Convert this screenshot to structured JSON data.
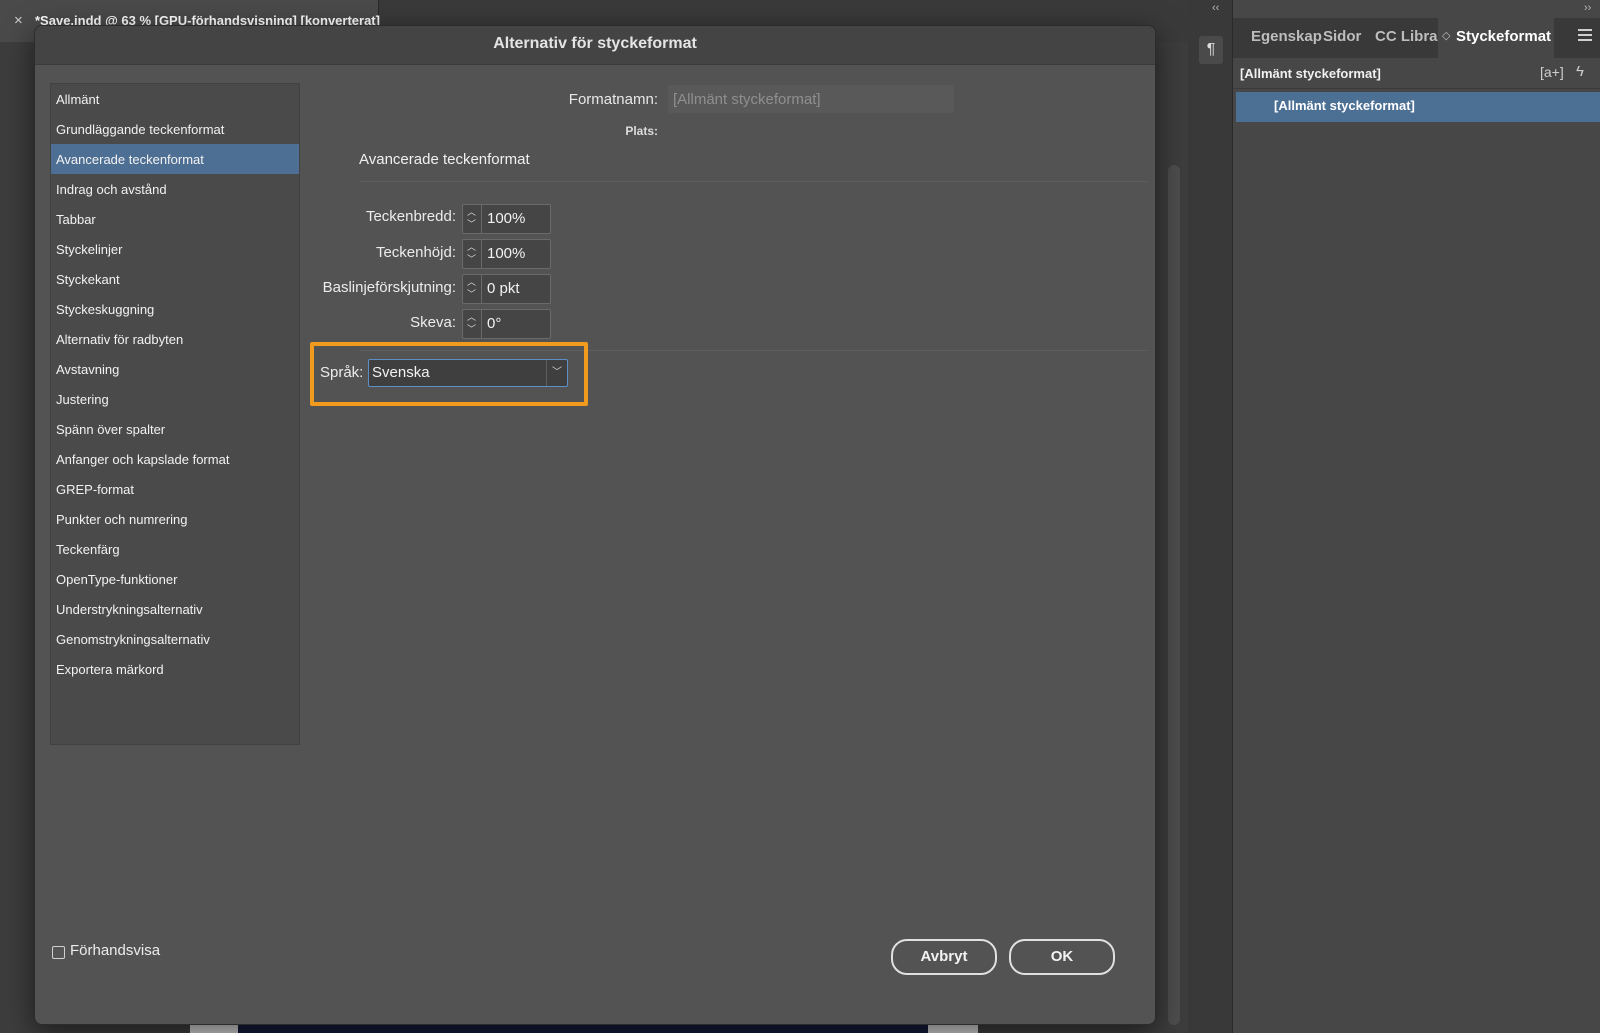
{
  "document_tab": {
    "close": "×",
    "title": "*Save.indd @ 63 % [GPU-förhandsvisning] [konverterat]"
  },
  "dialog": {
    "title": "Alternativ för styckeformat",
    "categories": [
      "Allmänt",
      "Grundläggande teckenformat",
      "Avancerade teckenformat",
      "Indrag och avstånd",
      "Tabbar",
      "Styckelinjer",
      "Styckekant",
      "Styckeskuggning",
      "Alternativ för radbyten",
      "Avstavning",
      "Justering",
      "Spänn över spalter",
      "Anfanger och kapslade format",
      "GREP-format",
      "Punkter och numrering",
      "Teckenfärg",
      "OpenType-funktioner",
      "Understrykningsalternativ",
      "Genomstrykningsalternativ",
      "Exportera märkord"
    ],
    "selected_category": "Avancerade teckenformat",
    "format_name_label": "Formatnamn:",
    "format_name_value": "[Allmänt styckeformat]",
    "location_label": "Plats:",
    "section_title": "Avancerade teckenformat",
    "fields": [
      {
        "label": "Teckenbredd:",
        "value": "100%"
      },
      {
        "label": "Teckenhöjd:",
        "value": "100%"
      },
      {
        "label": "Baslinjeförskjutning:",
        "value": "0 pkt"
      },
      {
        "label": "Skeva:",
        "value": "0°"
      }
    ],
    "language_label": "Språk:",
    "language_value": "Svenska",
    "highlight_color": "#f29a1e",
    "preview_label": "Förhandsvisa",
    "preview_checked": false,
    "cancel_label": "Avbryt",
    "ok_label": "OK"
  },
  "right_panel": {
    "collapse_left": "‹‹",
    "collapse_right": "››",
    "tabs": [
      "Egenskap",
      "Sidor",
      "CC Librar",
      "Styckeformat"
    ],
    "active_tab": "Styckeformat",
    "current_style": "[Allmänt styckeformat]",
    "new_group_icon": "[a+]",
    "bolt_icon": "ϟ",
    "items": [
      "[Allmänt styckeformat]"
    ],
    "selected_color": "#4c6f94"
  },
  "tool_strip": {
    "icon": "¶"
  }
}
